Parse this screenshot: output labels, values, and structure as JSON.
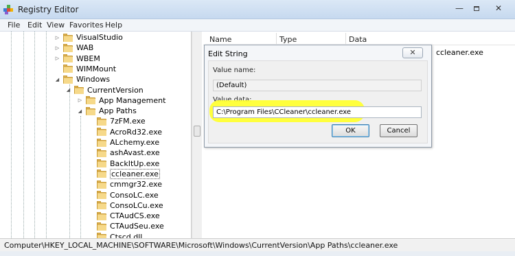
{
  "window": {
    "title": "Registry Editor"
  },
  "menu": [
    "File",
    "Edit",
    "View",
    "Favorites",
    "Help"
  ],
  "tree": [
    {
      "label": "VisualStudio",
      "expander": "closed"
    },
    {
      "label": "WAB",
      "expander": "closed"
    },
    {
      "label": "WBEM",
      "expander": "closed"
    },
    {
      "label": "WIMMount",
      "expander": "none"
    },
    {
      "label": "Windows",
      "expander": "open"
    },
    {
      "label": "CurrentVersion",
      "expander": "open"
    },
    {
      "label": "App Management",
      "expander": "closed"
    },
    {
      "label": "App Paths",
      "expander": "open"
    },
    {
      "label": "7zFM.exe",
      "expander": "none"
    },
    {
      "label": "AcroRd32.exe",
      "expander": "none"
    },
    {
      "label": "ALchemy.exe",
      "expander": "none"
    },
    {
      "label": "ashAvast.exe",
      "expander": "none"
    },
    {
      "label": "BackItUp.exe",
      "expander": "none"
    },
    {
      "label": "ccleaner.exe",
      "expander": "none",
      "selected": true
    },
    {
      "label": "cmmgr32.exe",
      "expander": "none"
    },
    {
      "label": "ConsoLC.exe",
      "expander": "none"
    },
    {
      "label": "ConsoLCu.exe",
      "expander": "none"
    },
    {
      "label": "CTAudCS.exe",
      "expander": "none"
    },
    {
      "label": "CTAudSeu.exe",
      "expander": "none"
    },
    {
      "label": "Ctscd.dll",
      "expander": "none"
    }
  ],
  "list": {
    "columns": [
      "Name",
      "Type",
      "Data"
    ],
    "visible_data": "ccleaner.exe"
  },
  "dialog": {
    "title": "Edit String",
    "close_glyph": "✕",
    "value_name_label": "Value name:",
    "value_name": "(Default)",
    "value_data_label": "Value data:",
    "value_data": "C:\\Program Files\\CCleaner\\ccleaner.exe",
    "ok_label": "OK",
    "cancel_label": "Cancel",
    "highlight_color": "#ffff33"
  },
  "status": {
    "path": "Computer\\HKEY_LOCAL_MACHINE\\SOFTWARE\\Microsoft\\Windows\\CurrentVersion\\App Paths\\ccleaner.exe"
  },
  "window_controls": {
    "minimize": "—",
    "close": "✕"
  },
  "colors": {
    "folder": "#e9c36b",
    "titlebar": "#c6d9ef"
  }
}
